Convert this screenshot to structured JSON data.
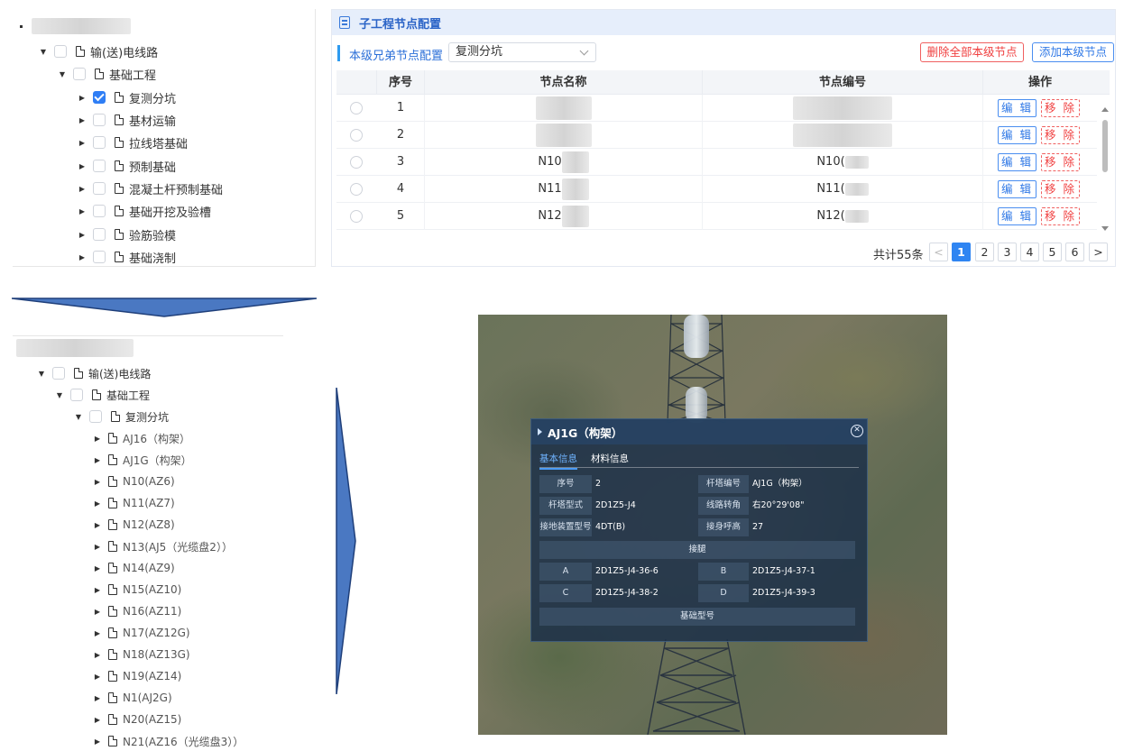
{
  "tree_top": {
    "items": [
      {
        "label": "输(送)电线路"
      },
      {
        "label": "基础工程"
      },
      {
        "label": "复测分坑",
        "checked": true
      },
      {
        "label": "基材运输"
      },
      {
        "label": "拉线塔基础"
      },
      {
        "label": "预制基础"
      },
      {
        "label": "混凝土杆预制基础"
      },
      {
        "label": "基础开挖及验槽"
      },
      {
        "label": "验筋验模"
      },
      {
        "label": "基础浇制"
      }
    ]
  },
  "panel": {
    "title": "子工程节点配置",
    "sibling_label": "本级兄弟节点配置",
    "sibling_select_value": "复测分坑",
    "delete_all_label": "删除全部本级节点",
    "add_label": "添加本级节点",
    "columns": [
      "序号",
      "节点名称",
      "节点编号",
      "操作"
    ],
    "rows": [
      {
        "index": "1",
        "name": "",
        "code": ""
      },
      {
        "index": "2",
        "name": "",
        "code": ""
      },
      {
        "index": "3",
        "name": "N10",
        "code": "N10("
      },
      {
        "index": "4",
        "name": "N11",
        "code": "N11("
      },
      {
        "index": "5",
        "name": "N12",
        "code": "N12("
      }
    ],
    "edit_label": "编 辑",
    "remove_label": "移 除",
    "total": "共计55条",
    "pages": [
      "1",
      "2",
      "3",
      "4",
      "5",
      "6"
    ],
    "current_page": "1",
    "prev_glyph": "<",
    "next_glyph": ">"
  },
  "tree_bottom": {
    "items": [
      {
        "label": "输(送)电线路"
      },
      {
        "label": "基础工程"
      },
      {
        "label": "复测分坑"
      },
      {
        "label": "AJ16（构架）"
      },
      {
        "label": "AJ1G（构架）"
      },
      {
        "label": "N10(AZ6)"
      },
      {
        "label": "N11(AZ7)"
      },
      {
        "label": "N12(AZ8)"
      },
      {
        "label": "N13(AJ5（光缆盘2））"
      },
      {
        "label": "N14(AZ9)"
      },
      {
        "label": "N15(AZ10)"
      },
      {
        "label": "N16(AZ11)"
      },
      {
        "label": "N17(AZ12G)"
      },
      {
        "label": "N18(AZ13G)"
      },
      {
        "label": "N19(AZ14)"
      },
      {
        "label": "N1(AJ2G)"
      },
      {
        "label": "N20(AZ15)"
      },
      {
        "label": "N21(AZ16（光缆盘3））"
      }
    ]
  },
  "popup": {
    "title": "AJ1G（构架）",
    "close_glyph": "✕",
    "tabs": [
      "基本信息",
      "材料信息"
    ],
    "fields": {
      "seq_key": "序号",
      "seq_val": "2",
      "tower_no_key": "杆塔编号",
      "tower_no_val": "AJ1G（构架）",
      "tower_type_key": "杆塔型式",
      "tower_type_val": "2D1Z5-J4",
      "angle_key": "线路转角",
      "angle_val": "右20°29'08\"",
      "ground_key": "接地装置型号",
      "ground_val": "4DT(B)",
      "height_key": "接身呼高",
      "height_val": "27"
    },
    "legs_title": "接腿",
    "legs": [
      {
        "k1": "A",
        "v1": "2D1Z5-J4-36-6",
        "k2": "B",
        "v2": "2D1Z5-J4-37-1"
      },
      {
        "k1": "C",
        "v1": "2D1Z5-J4-38-2",
        "k2": "D",
        "v2": "2D1Z5-J4-39-3"
      }
    ],
    "foundation_title": "基础型号"
  }
}
